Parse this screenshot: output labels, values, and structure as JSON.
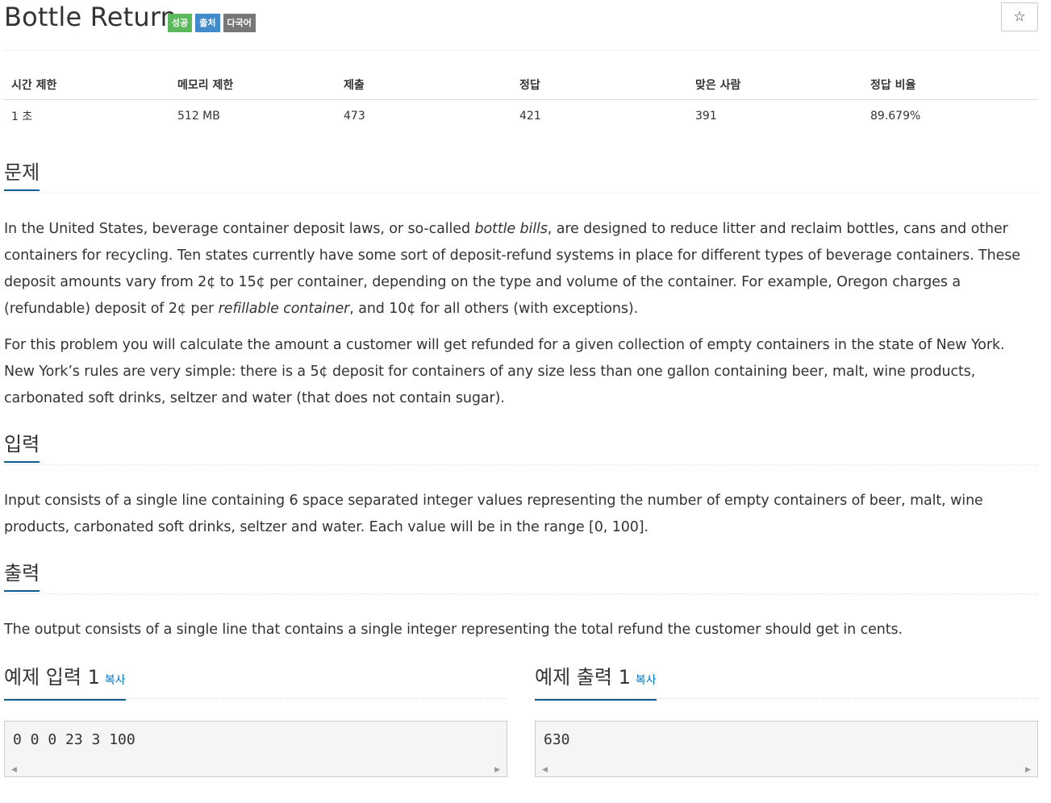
{
  "problem": {
    "title": "Bottle Return",
    "labels": [
      {
        "text": "성공",
        "color": "#5cb85c"
      },
      {
        "text": "출처",
        "color": "#428bca"
      },
      {
        "text": "다국어",
        "color": "#777777"
      }
    ],
    "star_icon": "☆"
  },
  "info_table": {
    "headers": [
      "시간 제한",
      "메모리 제한",
      "제출",
      "정답",
      "맞은 사람",
      "정답 비율"
    ],
    "values": [
      "1 초",
      "512 MB",
      "473",
      "421",
      "391",
      "89.679%"
    ]
  },
  "sections": {
    "problem_heading": "문제",
    "problem_p1_a": "In the United States, beverage container deposit laws, or so-called ",
    "problem_p1_em1": "bottle bills",
    "problem_p1_b": ", are designed to reduce litter and reclaim bottles, cans and other containers for recycling. Ten states currently have some sort of deposit-refund systems in place for different types of beverage containers. These deposit amounts vary from 2¢ to 15¢ per container, depending on the type and volume of the container. For example, Oregon charges a (refundable) deposit of 2¢ per ",
    "problem_p1_em2": "refillable container",
    "problem_p1_c": ", and 10¢ for all others (with exceptions).",
    "problem_p2": "For this problem you will calculate the amount a customer will get refunded for a given collection of empty containers in the state of New York. New York’s rules are very simple: there is a 5¢ deposit for containers of any size less than one gallon containing beer, malt, wine products, carbonated soft drinks, seltzer and water (that does not contain sugar).",
    "input_heading": "입력",
    "input_text": "Input consists of a single line containing 6 space separated integer values representing the number of empty containers of beer, malt, wine products, carbonated soft drinks, seltzer and water. Each value will be in the range [0, 100].",
    "output_heading": "출력",
    "output_text": "The output consists of a single line that contains a single integer representing the total refund the customer should get in cents."
  },
  "samples": {
    "input_title": "예제 입력 1",
    "output_title": "예제 출력 1",
    "copy_label": "복사",
    "input_value": "0 0 0 23 3 100",
    "output_value": "630",
    "scroll_left_icon": "◀",
    "scroll_right_icon": "▶"
  }
}
